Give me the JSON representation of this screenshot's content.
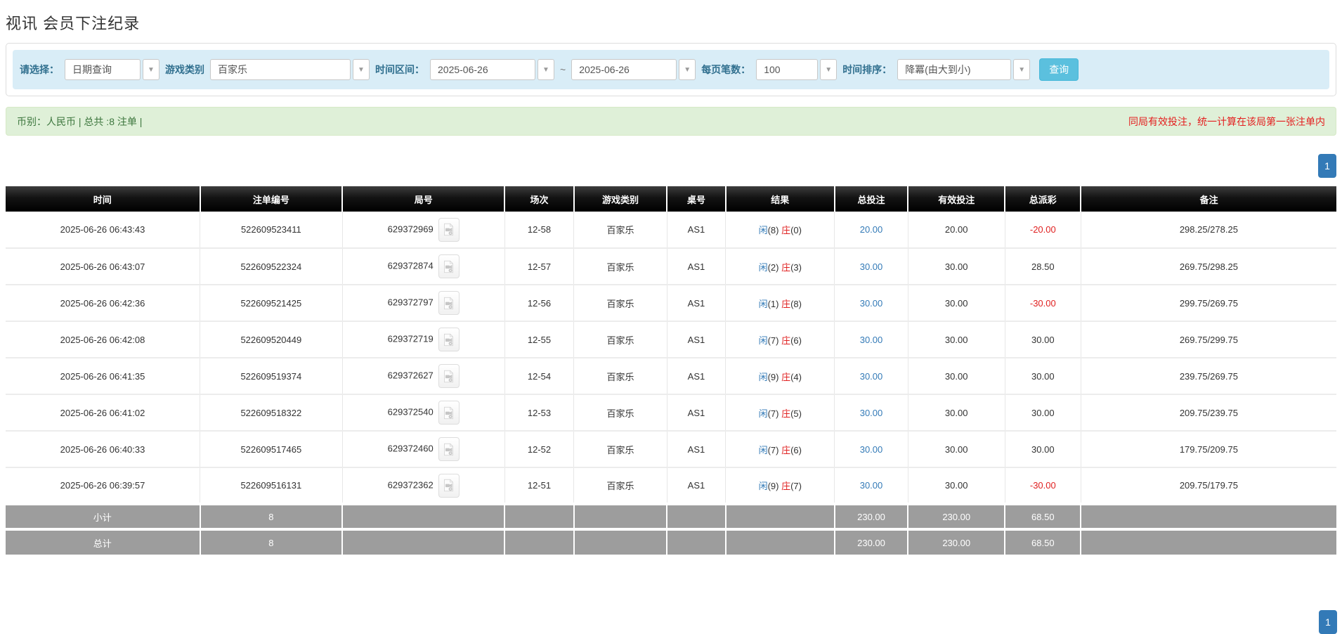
{
  "page": {
    "title": "视讯 会员下注纪录"
  },
  "icons": {
    "caret": "▼"
  },
  "colors": {
    "filter_bg": "#d9edf7",
    "label_blue": "#31708f",
    "search_cyan": "#5bc0de",
    "summary_green_bg": "#dff0d8",
    "notice_red": "#e41f1f",
    "link_blue": "#337ab7",
    "banker_red": "#e02020",
    "header_black": "#000000",
    "footer_grey": "#9d9d9d",
    "pagination_blue": "#337ab7"
  },
  "filters": {
    "select_label": "请选择：",
    "query_type": "日期查询",
    "game_type_label": "游戏类别",
    "game_type": "百家乐",
    "date_range_label": "时间区间：",
    "date_from": "2025-06-26",
    "tilde": "~",
    "date_to": "2025-06-26",
    "page_size_label": "每页笔数：",
    "page_size": "100",
    "sort_label": "时间排序：",
    "sort": "降冪(由大到小)",
    "search_button": "查询"
  },
  "summary": {
    "left": "币别：人民币 | 总共 :8 注单 |",
    "right_notice": "同局有效投注，统一计算在该局第一张注单内"
  },
  "pagination": {
    "page": "1"
  },
  "table": {
    "headers": [
      "时间",
      "注单编号",
      "局号",
      "场次",
      "游戏类别",
      "桌号",
      "结果",
      "总投注",
      "有效投注",
      "总派彩",
      "备注"
    ],
    "rows": [
      {
        "time": "2025-06-26 06:43:43",
        "bet_id": "522609523411",
        "round": "629372969",
        "session": "12-58",
        "game": "百家乐",
        "table_no": "AS1",
        "result": {
          "player_label": "闲",
          "player_score": "(8)",
          "banker_label": "庄",
          "banker_score": "(0)"
        },
        "total_bet": "20.00",
        "valid_bet": "20.00",
        "payout": "-20.00",
        "remark": "298.25/278.25"
      },
      {
        "time": "2025-06-26 06:43:07",
        "bet_id": "522609522324",
        "round": "629372874",
        "session": "12-57",
        "game": "百家乐",
        "table_no": "AS1",
        "result": {
          "player_label": "闲",
          "player_score": "(2)",
          "banker_label": "庄",
          "banker_score": "(3)"
        },
        "total_bet": "30.00",
        "valid_bet": "30.00",
        "payout": "28.50",
        "remark": "269.75/298.25"
      },
      {
        "time": "2025-06-26 06:42:36",
        "bet_id": "522609521425",
        "round": "629372797",
        "session": "12-56",
        "game": "百家乐",
        "table_no": "AS1",
        "result": {
          "player_label": "闲",
          "player_score": "(1)",
          "banker_label": "庄",
          "banker_score": "(8)"
        },
        "total_bet": "30.00",
        "valid_bet": "30.00",
        "payout": "-30.00",
        "remark": "299.75/269.75"
      },
      {
        "time": "2025-06-26 06:42:08",
        "bet_id": "522609520449",
        "round": "629372719",
        "session": "12-55",
        "game": "百家乐",
        "table_no": "AS1",
        "result": {
          "player_label": "闲",
          "player_score": "(7)",
          "banker_label": "庄",
          "banker_score": "(6)"
        },
        "total_bet": "30.00",
        "valid_bet": "30.00",
        "payout": "30.00",
        "remark": "269.75/299.75"
      },
      {
        "time": "2025-06-26 06:41:35",
        "bet_id": "522609519374",
        "round": "629372627",
        "session": "12-54",
        "game": "百家乐",
        "table_no": "AS1",
        "result": {
          "player_label": "闲",
          "player_score": "(9)",
          "banker_label": "庄",
          "banker_score": "(4)"
        },
        "total_bet": "30.00",
        "valid_bet": "30.00",
        "payout": "30.00",
        "remark": "239.75/269.75"
      },
      {
        "time": "2025-06-26 06:41:02",
        "bet_id": "522609518322",
        "round": "629372540",
        "session": "12-53",
        "game": "百家乐",
        "table_no": "AS1",
        "result": {
          "player_label": "闲",
          "player_score": "(7)",
          "banker_label": "庄",
          "banker_score": "(5)"
        },
        "total_bet": "30.00",
        "valid_bet": "30.00",
        "payout": "30.00",
        "remark": "209.75/239.75"
      },
      {
        "time": "2025-06-26 06:40:33",
        "bet_id": "522609517465",
        "round": "629372460",
        "session": "12-52",
        "game": "百家乐",
        "table_no": "AS1",
        "result": {
          "player_label": "闲",
          "player_score": "(7)",
          "banker_label": "庄",
          "banker_score": "(6)"
        },
        "total_bet": "30.00",
        "valid_bet": "30.00",
        "payout": "30.00",
        "remark": "179.75/209.75"
      },
      {
        "time": "2025-06-26 06:39:57",
        "bet_id": "522609516131",
        "round": "629372362",
        "session": "12-51",
        "game": "百家乐",
        "table_no": "AS1",
        "result": {
          "player_label": "闲",
          "player_score": "(9)",
          "banker_label": "庄",
          "banker_score": "(7)"
        },
        "total_bet": "30.00",
        "valid_bet": "30.00",
        "payout": "-30.00",
        "remark": "209.75/179.75"
      }
    ],
    "footer_rows": [
      {
        "label": "小计",
        "count": "8",
        "total_bet": "230.00",
        "valid_bet": "230.00",
        "payout": "68.50"
      },
      {
        "label": "总计",
        "count": "8",
        "total_bet": "230.00",
        "valid_bet": "230.00",
        "payout": "68.50"
      }
    ]
  }
}
